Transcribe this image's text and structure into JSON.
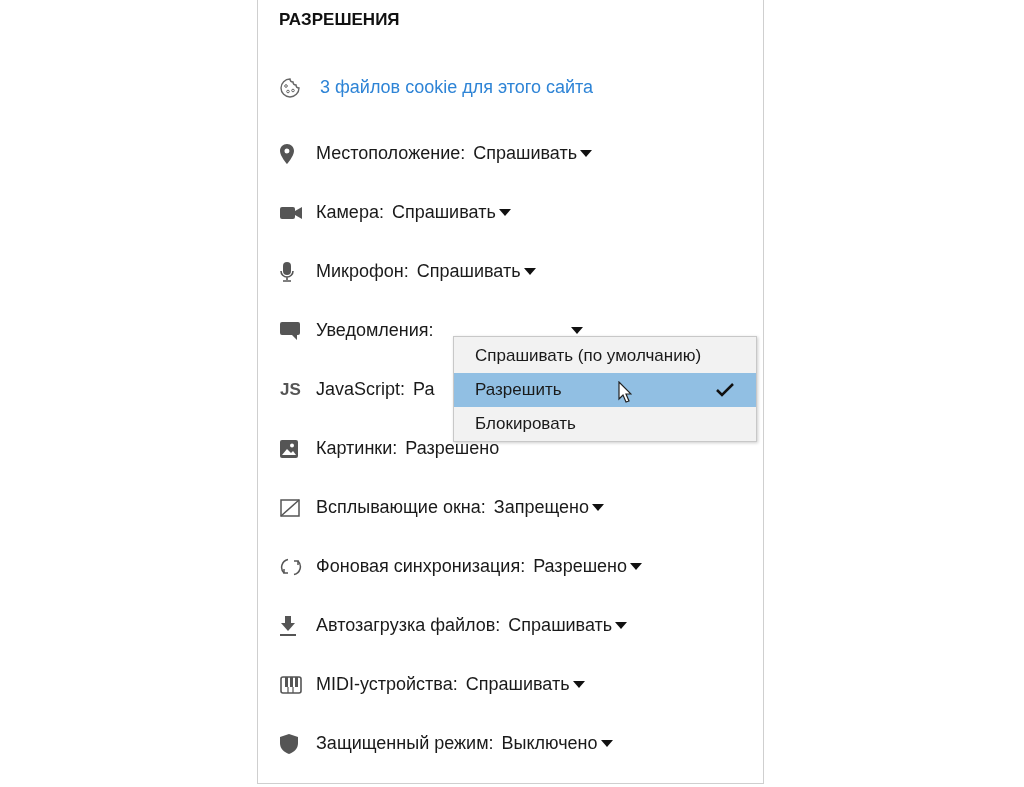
{
  "section": {
    "title": "РАЗРЕШЕНИЯ"
  },
  "cookies": {
    "label": "3 файлов cookie для этого сайта"
  },
  "permissions": [
    {
      "kind": "location",
      "label": "Местоположение:",
      "value": "Спрашивать"
    },
    {
      "kind": "camera",
      "label": "Камера:",
      "value": "Спрашивать"
    },
    {
      "kind": "mic",
      "label": "Микрофон:",
      "value": "Спрашивать"
    },
    {
      "kind": "notifications",
      "label": "Уведомления:",
      "expanded": true
    },
    {
      "kind": "js",
      "icon_text": "JS",
      "label": "JavaScript:",
      "value": "Ра"
    },
    {
      "kind": "image",
      "label": "Картинки:",
      "value": "Разрешено"
    },
    {
      "kind": "popup",
      "label": "Всплывающие окна:",
      "value": "Запрещено"
    },
    {
      "kind": "sync",
      "label": "Фоновая синхронизация:",
      "value": "Разрешено"
    },
    {
      "kind": "download",
      "label": "Автозагрузка файлов:",
      "value": "Спрашивать"
    },
    {
      "kind": "midi",
      "label": "MIDI-устройства:",
      "value": "Спрашивать"
    },
    {
      "kind": "shield",
      "label": "Защищенный режим:",
      "value": "Выключено"
    }
  ],
  "menu_options": [
    {
      "label": "Спрашивать (по умолчанию)",
      "selected": false
    },
    {
      "label": "Разрешить",
      "selected": true
    },
    {
      "label": "Блокировать",
      "selected": false
    }
  ]
}
